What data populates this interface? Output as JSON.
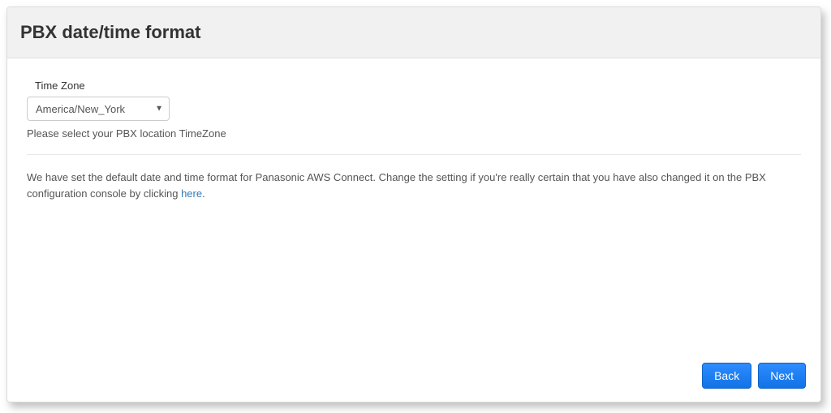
{
  "header": {
    "title": "PBX date/time format"
  },
  "form": {
    "timezone_label": "Time Zone",
    "timezone_value": "America/New_York",
    "timezone_help": "Please select your PBX location TimeZone"
  },
  "info": {
    "text": "We have set the default date and time format for Panasonic AWS Connect. Change the setting if you're really certain that you have also changed it on the PBX configuration console by clicking ",
    "link_text": "here",
    "suffix": "."
  },
  "footer": {
    "back_label": "Back",
    "next_label": "Next"
  }
}
